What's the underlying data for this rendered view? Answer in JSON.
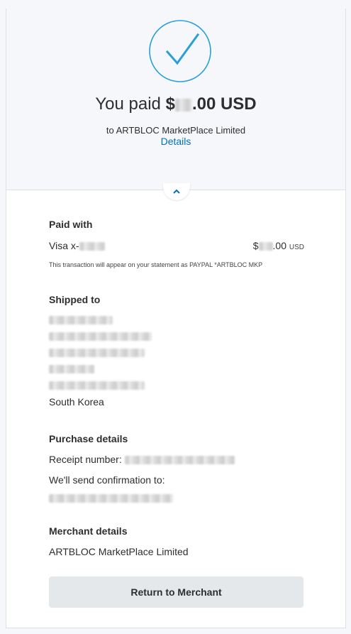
{
  "hero": {
    "icon": "check-circle-icon",
    "accent_color": "#2a9fd6",
    "amount_prefix": "You paid ",
    "amount_currency_symbol": "$",
    "amount_suffix": ".00 USD",
    "merchant_line": "to ARTBLOC MarketPlace Limited",
    "details_label": "Details"
  },
  "collapse": {
    "icon": "chevron-up-icon"
  },
  "paid_with": {
    "title": "Paid with",
    "method_label": "Visa x-",
    "amount_symbol": "$",
    "amount_suffix": ".00",
    "currency": "USD",
    "statement_note": "This transaction will appear on your statement as PAYPAL *ARTBLOC MKP"
  },
  "shipped_to": {
    "title": "Shipped to",
    "country": "South Korea"
  },
  "purchase_details": {
    "title": "Purchase details",
    "receipt_label": "Receipt number: ",
    "confirmation_label": "We'll send confirmation to:"
  },
  "merchant_details": {
    "title": "Merchant details",
    "name": "ARTBLOC MarketPlace Limited"
  },
  "return_button": {
    "label": "Return to Merchant"
  }
}
